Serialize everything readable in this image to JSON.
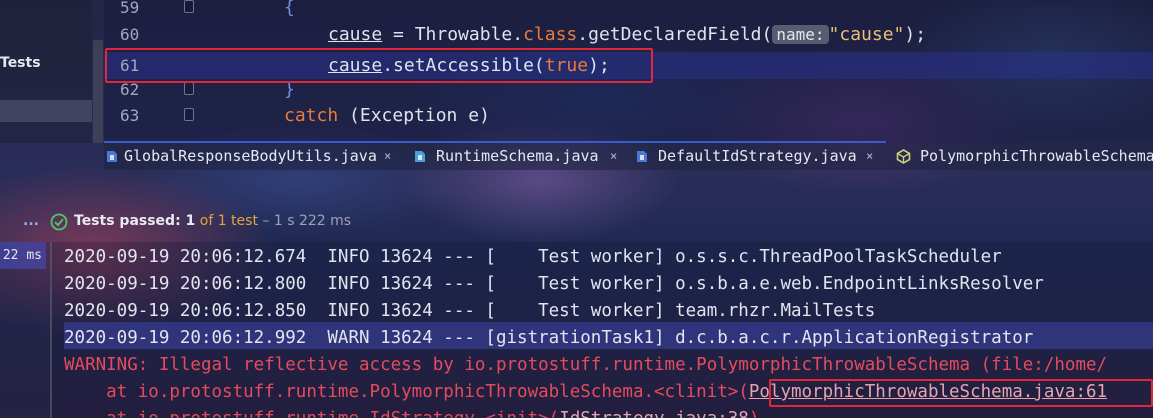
{
  "colors": {
    "keyword": "#ea7b3b",
    "string": "#e8c075",
    "brace": "#6f8fe0",
    "error_text": "#e54b5c",
    "highlight_box": "#e0283a",
    "selected_line": "#28328c",
    "passed_icon": "#4cc76a"
  },
  "project_panel": {
    "tree_item_label": "Tests"
  },
  "editor": {
    "lines": [
      {
        "number": "59",
        "brace": "{"
      },
      {
        "number": "60",
        "var": "cause",
        "eq": " = Throwable.",
        "kw": "class",
        "call": ".getDeclaredField(",
        "hint": "name:",
        "str": "\"cause\"",
        "end": ");"
      },
      {
        "number": "61",
        "var": "cause",
        "call": ".setAccessible(",
        "kw": "true",
        "end": ");"
      },
      {
        "number": "62",
        "brace": "}"
      },
      {
        "number": "63",
        "kw": "catch",
        "rest": " (Exception e)"
      }
    ]
  },
  "tabs": [
    {
      "label": "GlobalResponseBodyUtils.java",
      "icon": "java-class-icon",
      "close": "×"
    },
    {
      "label": "RuntimeSchema.java",
      "icon": "java-class-icon",
      "close": "×"
    },
    {
      "label": "DefaultIdStrategy.java",
      "icon": "java-class-icon",
      "close": "×"
    },
    {
      "label": "PolymorphicThrowableSchema",
      "icon": "read-only-class-icon"
    }
  ],
  "run_header": {
    "ellipsis": "...",
    "status_icon": "check-icon",
    "passed_label": "Tests passed: ",
    "passed_count": "1",
    "of_text": "of 1 test",
    "dash": " – ",
    "duration": "1 s 222 ms"
  },
  "test_tree": {
    "duration": "22 ms"
  },
  "console": {
    "log_rows": [
      "2020-09-19 20:06:12.674  INFO 13624 --- [    Test worker] o.s.s.c.ThreadPoolTaskScheduler",
      "2020-09-19 20:06:12.800  INFO 13624 --- [    Test worker] o.s.b.a.e.web.EndpointLinksResolver",
      "2020-09-19 20:06:12.850  INFO 13624 --- [    Test worker] team.rhzr.MailTests",
      "2020-09-19 20:06:12.992  WARN 13624 --- [gistrationTask1] d.c.b.a.c.r.ApplicationRegistrator"
    ],
    "warning_row": "WARNING: Illegal reflective access by io.protostuff.runtime.PolymorphicThrowableSchema (file:/home/",
    "stack_row_prefix": "    at io.protostuff.runtime.PolymorphicThrowableSchema.<clinit>(",
    "stack_row_link": "PolymorphicThrowableSchema.java:61",
    "stack_row_2_prefix": "    at io.protostuff.runtime.IdStrategy.<init>(",
    "stack_row_2_link": "IdStrategy.java:38",
    "stack_row_2_suffix": ")"
  }
}
